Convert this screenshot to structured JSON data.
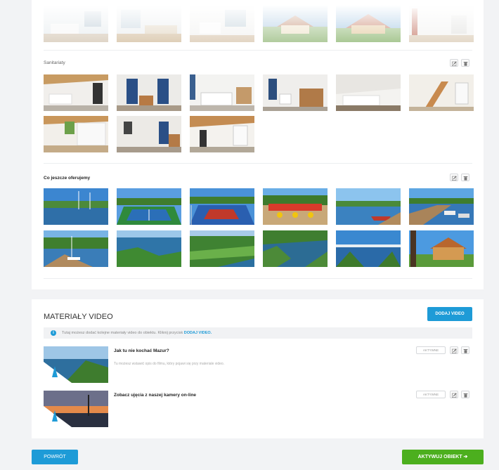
{
  "sections": {
    "sanitariaty_title": "Sanitariaty",
    "extras_title": "Co jeszcze oferujemy"
  },
  "videos": {
    "title": "MATERIAŁY VIDEO",
    "add_button": "DODAJ VIDEO",
    "info_text": "Tutaj możesz dodać kolejne materiały video do obiektu. Kliknij przycisk",
    "info_link": "DODAJ VIDEO.",
    "items": [
      {
        "title": "Jak tu nie kochać Mazur?",
        "description": "Tu możesz wstawić opis do filmu, który pojawi się przy materiale video.",
        "status": "AKTYWNE"
      },
      {
        "title": "Zobacz ujęcia z naszej kamery on-line",
        "description": "",
        "status": "AKTYWNE"
      }
    ]
  },
  "footer": {
    "back_label": "POWRÓT",
    "activate_label": "AKTYWUJ OBIEKT ➔"
  },
  "icons": {
    "edit": "pencil-square-icon",
    "delete": "trash-icon",
    "info": "info-circle-icon"
  },
  "colors": {
    "primary": "#1e9bd7",
    "success": "#4caf1e"
  }
}
